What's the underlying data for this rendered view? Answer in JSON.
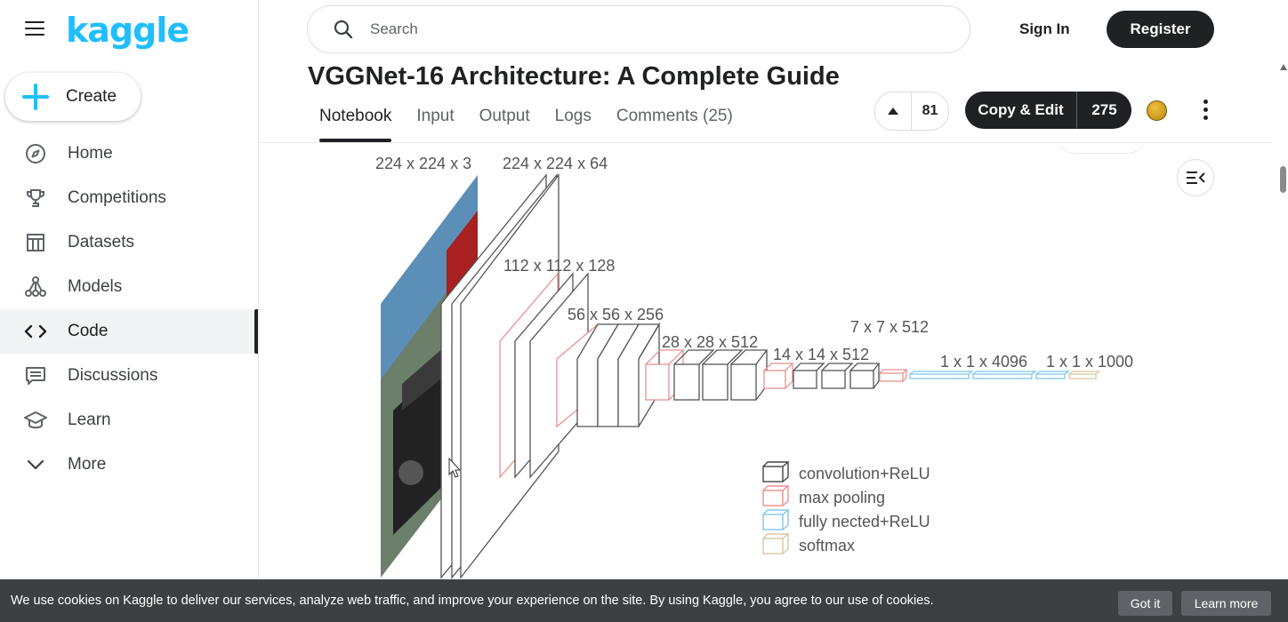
{
  "sidebar": {
    "logo": "kaggle",
    "create_label": "Create",
    "items": [
      {
        "label": "Home",
        "icon": "compass-icon"
      },
      {
        "label": "Competitions",
        "icon": "trophy-icon"
      },
      {
        "label": "Datasets",
        "icon": "table-icon"
      },
      {
        "label": "Models",
        "icon": "models-icon"
      },
      {
        "label": "Code",
        "icon": "code-icon",
        "active": true
      },
      {
        "label": "Discussions",
        "icon": "discussion-icon"
      },
      {
        "label": "Learn",
        "icon": "graduation-cap-icon"
      },
      {
        "label": "More",
        "icon": "chevron-down-icon"
      }
    ]
  },
  "header": {
    "search_placeholder": "Search",
    "sign_in": "Sign In",
    "register": "Register"
  },
  "notebook": {
    "title": "VGGNet-16 Architecture: A Complete Guide",
    "tabs": [
      "Notebook",
      "Input",
      "Output",
      "Logs",
      "Comments (25)"
    ],
    "active_tab": "Notebook",
    "votes": "81",
    "copy_edit_label": "Copy & Edit",
    "copy_edit_count": "275"
  },
  "diagram": {
    "labels": {
      "input": "224 x 224 x 3",
      "conv1": "224 x 224 x 64",
      "conv2": "112 x 112 x 128",
      "conv3": "56 x 56 x 256",
      "conv4": "28 x 28 x 512",
      "conv5": "14 x 14 x 512",
      "pool5": "7 x 7 x 512",
      "fc": "1 x 1 x 4096",
      "out": "1 x 1 x 1000"
    },
    "legend": [
      {
        "label": "convolution+ReLU",
        "color": "#444444"
      },
      {
        "label": "max pooling",
        "color": "#e8918f"
      },
      {
        "label": "fully nected+ReLU",
        "color": "#7fc8e8"
      },
      {
        "label": "softmax",
        "color": "#d9c9a3"
      }
    ]
  },
  "cookie": {
    "text": "We use cookies on Kaggle to deliver our services, analyze web traffic, and improve your experience on the site. By using Kaggle, you agree to our use of cookies.",
    "got_it": "Got it",
    "learn_more": "Learn more"
  },
  "colors": {
    "brand": "#20beff",
    "dark": "#202124",
    "cookie_bg": "#3c4043"
  }
}
